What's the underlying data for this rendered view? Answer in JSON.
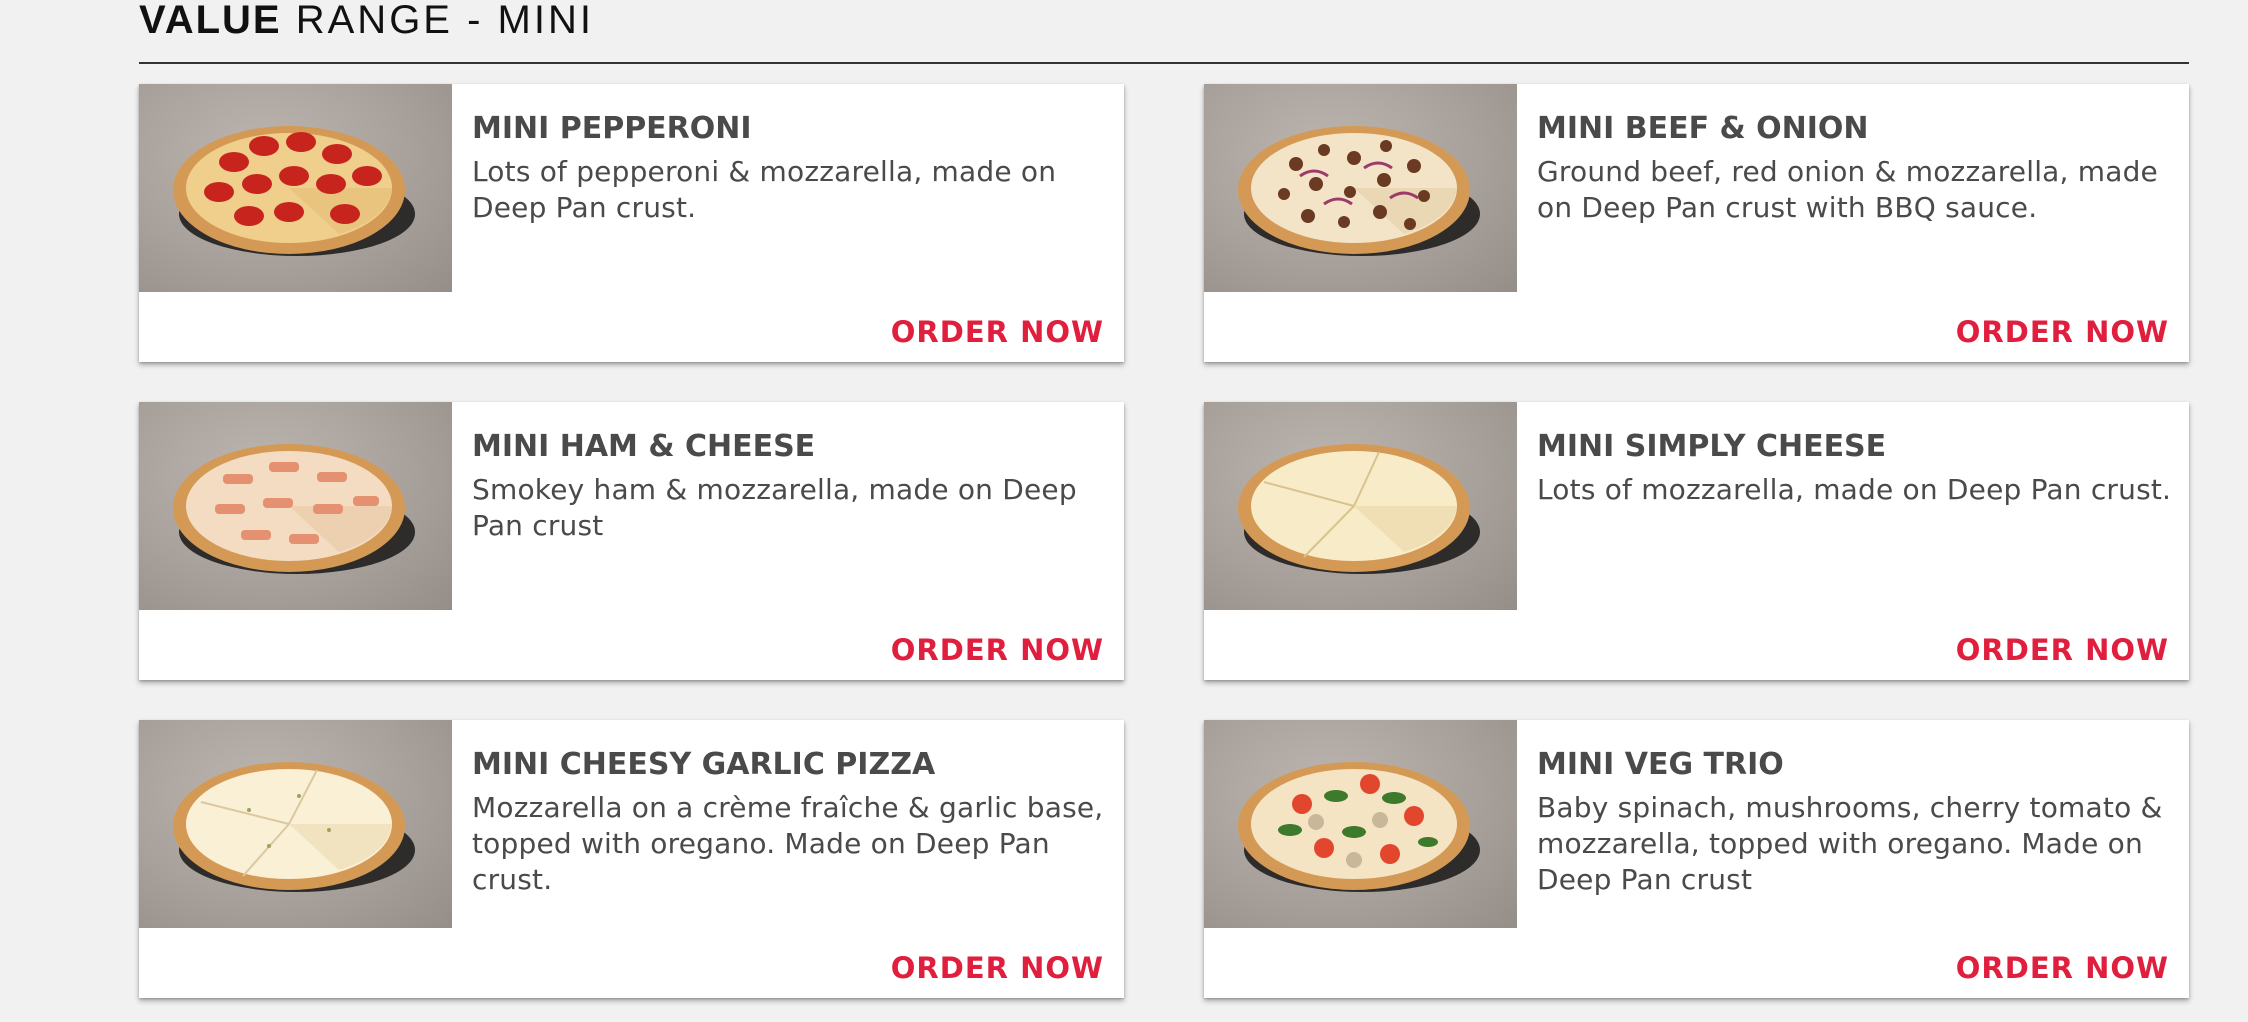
{
  "section": {
    "title_bold": "VALUE",
    "title_light": "RANGE - MINI"
  },
  "colors": {
    "accent": "#e01e3d",
    "text": "#4a4a4a",
    "background": "#f1f1f1"
  },
  "products": [
    {
      "name": "MINI PEPPERONI",
      "description": "Lots of pepperoni & mozzarella, made on Deep Pan crust.",
      "cta": "ORDER NOW",
      "image_icon": "pepperoni-pizza-image"
    },
    {
      "name": "MINI BEEF & ONION",
      "description": "Ground beef, red onion & mozzarella, made on Deep Pan crust with BBQ sauce.",
      "cta": "ORDER NOW",
      "image_icon": "beef-onion-pizza-image"
    },
    {
      "name": "MINI HAM & CHEESE",
      "description": "Smokey ham & mozzarella, made on Deep Pan crust",
      "cta": "ORDER NOW",
      "image_icon": "ham-cheese-pizza-image"
    },
    {
      "name": "MINI SIMPLY CHEESE",
      "description": "Lots of mozzarella, made on Deep Pan crust.",
      "cta": "ORDER NOW",
      "image_icon": "cheese-pizza-image"
    },
    {
      "name": "MINI CHEESY GARLIC PIZZA",
      "description": "Mozzarella on a crème fraîche & garlic base, topped with oregano. Made on Deep Pan crust.",
      "cta": "ORDER NOW",
      "image_icon": "garlic-pizza-image"
    },
    {
      "name": "MINI VEG TRIO",
      "description": "Baby spinach, mushrooms, cherry tomato & mozzarella, topped with oregano. Made on Deep Pan crust",
      "cta": "ORDER NOW",
      "image_icon": "veg-trio-pizza-image"
    }
  ]
}
